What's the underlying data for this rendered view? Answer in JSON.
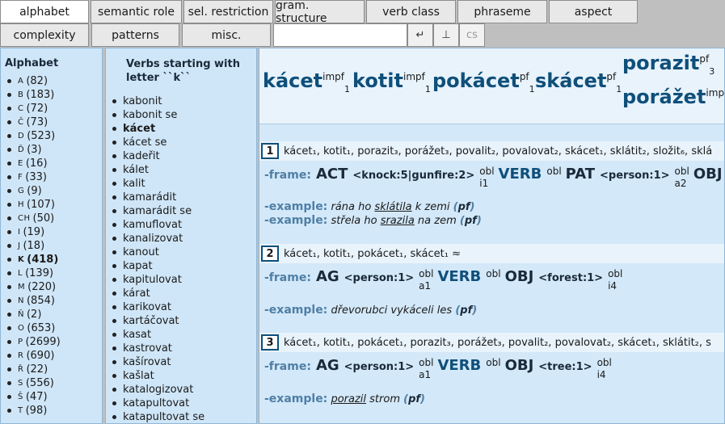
{
  "tabs_row1": [
    "alphabet",
    "semantic role",
    "sel. restriction",
    "gram. structure",
    "verb class",
    "phraseme",
    "aspect"
  ],
  "tabs_row2": [
    "complexity",
    "patterns",
    "misc."
  ],
  "search": {
    "value": "",
    "placeholder": "",
    "btn_enter": "↵",
    "btn_perp": "⊥",
    "btn_cs": "cs"
  },
  "alphabet": {
    "title": "Alphabet",
    "items": [
      {
        "letter": "A",
        "count": "(82)"
      },
      {
        "letter": "B",
        "count": "(183)"
      },
      {
        "letter": "C",
        "count": "(72)"
      },
      {
        "letter": "Č",
        "count": "(73)"
      },
      {
        "letter": "D",
        "count": "(523)"
      },
      {
        "letter": "Ď",
        "count": "(3)"
      },
      {
        "letter": "E",
        "count": "(16)"
      },
      {
        "letter": "F",
        "count": "(33)"
      },
      {
        "letter": "G",
        "count": "(9)"
      },
      {
        "letter": "H",
        "count": "(107)"
      },
      {
        "letter": "CH",
        "count": "(50)"
      },
      {
        "letter": "I",
        "count": "(19)"
      },
      {
        "letter": "J",
        "count": "(18)"
      },
      {
        "letter": "K",
        "count": "(418)"
      },
      {
        "letter": "L",
        "count": "(139)"
      },
      {
        "letter": "M",
        "count": "(220)"
      },
      {
        "letter": "N",
        "count": "(854)"
      },
      {
        "letter": "Ň",
        "count": "(2)"
      },
      {
        "letter": "O",
        "count": "(653)"
      },
      {
        "letter": "P",
        "count": "(2699)"
      },
      {
        "letter": "R",
        "count": "(690)"
      },
      {
        "letter": "Ř",
        "count": "(22)"
      },
      {
        "letter": "S",
        "count": "(556)"
      },
      {
        "letter": "Š",
        "count": "(47)"
      },
      {
        "letter": "T",
        "count": "(98)"
      }
    ]
  },
  "verbs": {
    "title": "Verbs starting with letter ``k``",
    "items": [
      "kabonit",
      "kabonit se",
      "kácet",
      "kácet se",
      "kadeřit",
      "kálet",
      "kalit",
      "kamarádit",
      "kamarádit se",
      "kamuflovat",
      "kanalizovat",
      "kanout",
      "kapat",
      "kapitulovat",
      "kárat",
      "karikovat",
      "kartáčovat",
      "kasat",
      "kastrovat",
      "kašírovat",
      "kašlat",
      "katalogizovat",
      "katapultovat",
      "katapultovat se"
    ]
  },
  "headwords": [
    {
      "word": "kácet",
      "aspect": "impf",
      "num": "1"
    },
    {
      "word": "kotit",
      "aspect": "impf",
      "num": "1"
    },
    {
      "word": "pokácet",
      "aspect": "pf",
      "num": "1"
    },
    {
      "word": "skácet",
      "aspect": "pf",
      "num": "1"
    },
    {
      "word": "porazit",
      "aspect": "pf",
      "num": "3"
    },
    {
      "word": "porážet",
      "aspect": "imp",
      "num": "3"
    }
  ],
  "labels": {
    "frame": "-frame:",
    "example": "-example:",
    "obl": "obl"
  },
  "frames": [
    {
      "num": "1",
      "synonyms": "kácet₁, kotit₁, porazit₃, porážet₃, povalit₂, povalovat₂, skácet₁, sklátit₂, složit₆, sklá",
      "slot1": {
        "role": "ACT",
        "restr": "<knock:5|gunfire:2>",
        "obl": "obl",
        "form": "i1"
      },
      "verb": {
        "label": "VERB",
        "obl": "obl"
      },
      "slot2": {
        "role": "PAT",
        "restr": "<person:1>",
        "obl": "obl",
        "form": "a2"
      },
      "slot3": {
        "role": "OBJ"
      },
      "examples": [
        {
          "pre": "rána ho ",
          "u": "sklátila",
          "post": " k zemi ",
          "pf": "pf"
        },
        {
          "pre": "střela ho ",
          "u": "srazila",
          "post": " na zem ",
          "pf": "pf"
        }
      ]
    },
    {
      "num": "2",
      "synonyms": "kácet₁, kotit₁, pokácet₁, skácet₁ ≈",
      "slot1": {
        "role": "AG",
        "restr": "<person:1>",
        "obl": "obl",
        "form": "a1"
      },
      "verb": {
        "label": "VERB",
        "obl": "obl"
      },
      "slot2": {
        "role": "OBJ",
        "restr": "<forest:1>",
        "obl": "obl",
        "form": "i4"
      },
      "examples": [
        {
          "pre": "dřevorubci vykáceli les ",
          "u": "",
          "post": "",
          "pf": "pf"
        }
      ]
    },
    {
      "num": "3",
      "synonyms": "kácet₁, kotit₁, pokácet₁, porazit₃, porážet₃, povalit₂, povalovat₂, skácet₁, sklátit₂, s",
      "slot1": {
        "role": "AG",
        "restr": "<person:1>",
        "obl": "obl",
        "form": "a1"
      },
      "verb": {
        "label": "VERB",
        "obl": "obl"
      },
      "slot2": {
        "role": "OBJ",
        "restr": "<tree:1>",
        "obl": "obl",
        "form": "i4"
      },
      "examples": [
        {
          "pre": "",
          "u": "porazil",
          "post": " strom ",
          "pf": "pf"
        }
      ]
    }
  ]
}
